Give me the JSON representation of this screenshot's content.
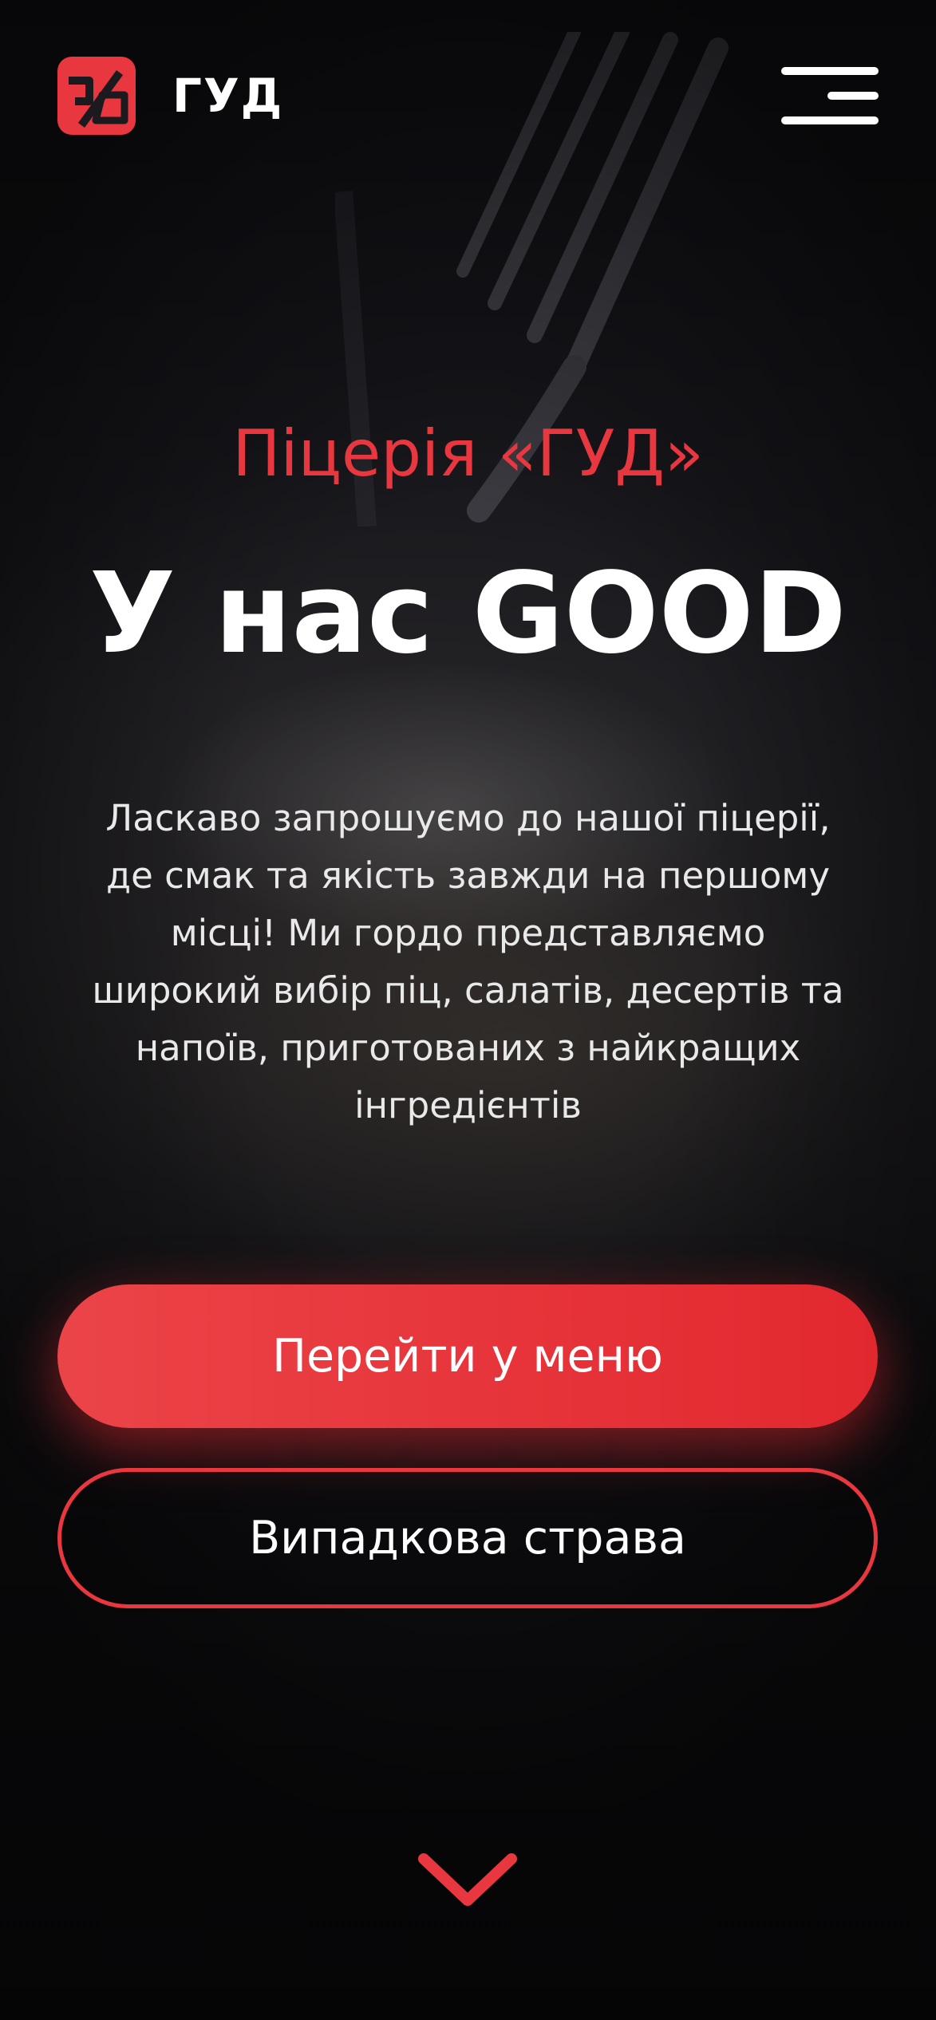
{
  "brand": {
    "name": "ГУД",
    "accent_color": "#e8373f",
    "logo_icon": "brand-logo-icon"
  },
  "header": {
    "menu_icon": "hamburger-menu-icon"
  },
  "hero": {
    "eyebrow": "Піцерія «ГУД»",
    "title": "У нас GOOD",
    "description_lines": [
      "Ласкаво запрошуємо до нашої піцерії,",
      "де смак та якість завжди на першому",
      "місці! Ми гордо представляємо",
      "широкий вибір піц, салатів, десертів та",
      "напоїв, приготованих з найкращих",
      "інгредієнтів"
    ],
    "primary_button": "Перейти у меню",
    "secondary_button": "Випадкова страва",
    "scroll_icon": "chevron-down-icon"
  }
}
